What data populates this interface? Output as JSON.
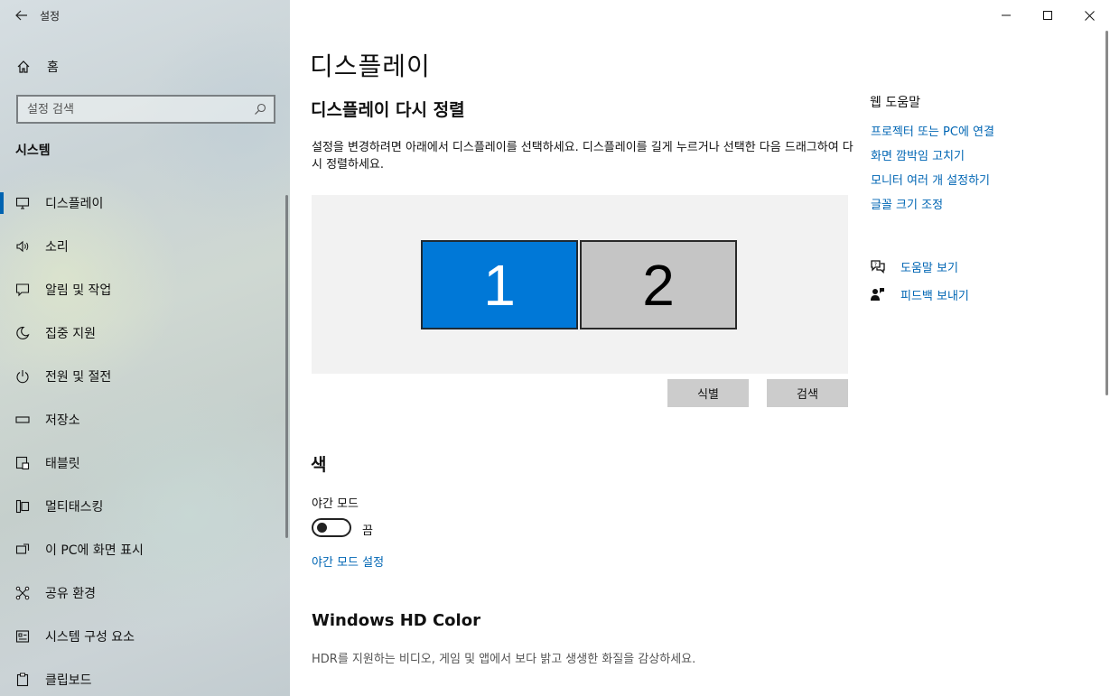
{
  "window": {
    "title": "설정",
    "controls": {
      "minimize": "minimize",
      "maximize": "maximize",
      "close": "close"
    }
  },
  "sidebar": {
    "home_label": "홈",
    "search_placeholder": "설정 검색",
    "section": "시스템",
    "items": [
      {
        "label": "디스플레이",
        "icon": "monitor-icon",
        "active": true
      },
      {
        "label": "소리",
        "icon": "speaker-icon"
      },
      {
        "label": "알림 및 작업",
        "icon": "notification-icon"
      },
      {
        "label": "집중 지원",
        "icon": "moon-icon"
      },
      {
        "label": "전원 및 절전",
        "icon": "power-icon"
      },
      {
        "label": "저장소",
        "icon": "storage-icon"
      },
      {
        "label": "태블릿",
        "icon": "tablet-icon"
      },
      {
        "label": "멀티태스킹",
        "icon": "multitask-icon"
      },
      {
        "label": "이 PC에 화면 표시",
        "icon": "project-icon"
      },
      {
        "label": "공유 환경",
        "icon": "share-icon"
      },
      {
        "label": "시스템 구성 요소",
        "icon": "components-icon"
      },
      {
        "label": "클립보드",
        "icon": "clipboard-icon"
      }
    ]
  },
  "main": {
    "title": "디스플레이",
    "rearrange_title": "디스플레이 다시 정렬",
    "rearrange_desc": "설정을 변경하려면 아래에서 디스플레이를 선택하세요. 디스플레이를 길게 누르거나 선택한 다음 드래그하여 다시 정렬하세요.",
    "monitors": [
      "1",
      "2"
    ],
    "identify_label": "식별",
    "detect_label": "검색",
    "color_title": "색",
    "night_mode_label": "야간 모드",
    "night_mode_state": "끔",
    "night_mode_link": "야간 모드 설정",
    "hd_title": "Windows HD Color",
    "hd_desc": "HDR를 지원하는 비디오, 게임 및 앱에서 보다 밝고 생생한 화질을 감상하세요."
  },
  "right": {
    "title": "웹 도움말",
    "links": [
      "프로젝터 또는 PC에 연결",
      "화면 깜박임 고치기",
      "모니터 여러 개 설정하기",
      "글꼴 크기 조정"
    ],
    "help_label": "도움말 보기",
    "feedback_label": "피드백 보내기"
  },
  "colors": {
    "accent": "#0078d7",
    "link": "#0066b4"
  }
}
